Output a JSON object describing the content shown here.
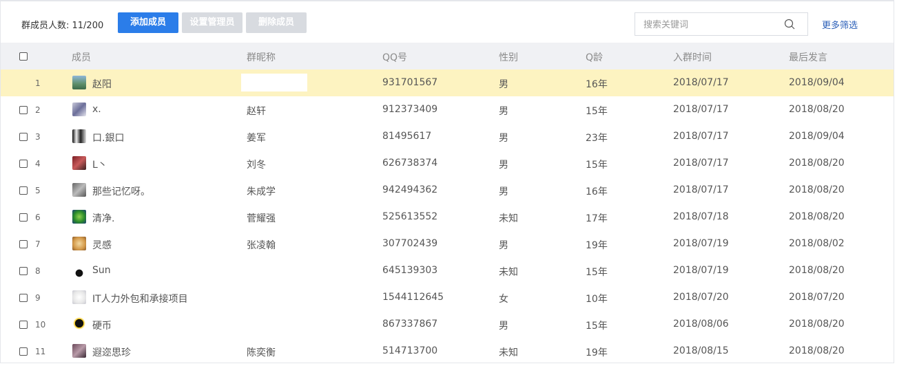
{
  "toolbar": {
    "count_label": "群成员人数: 11/200",
    "add_label": "添加成员",
    "admin_label": "设置管理员",
    "delete_label": "删除成员",
    "search_placeholder": "搜索关键词",
    "more_filter": "更多筛选"
  },
  "columns": {
    "member": "成员",
    "nickname": "群昵称",
    "qq": "QQ号",
    "gender": "性别",
    "qage": "Q龄",
    "join": "入群时间",
    "last": "最后发言"
  },
  "colors": {
    "primary": "#2b7de9",
    "disabled": "#d8dbe0",
    "highlight_row": "#fdf3c1",
    "header_bg": "#f0f1f4",
    "link": "#2b5fb8"
  },
  "rows": [
    {
      "idx": "1",
      "name": "赵阳",
      "nick": "",
      "qq": "931701567",
      "gender": "男",
      "qage": "16年",
      "join": "2018/07/17",
      "last": "2018/09/04",
      "avatar": "landscape-avatar",
      "highlight": true
    },
    {
      "idx": "2",
      "name": "x.",
      "nick": "赵轩",
      "qq": "912373409",
      "gender": "男",
      "qage": "15年",
      "join": "2018/07/17",
      "last": "2018/08/20",
      "avatar": "anime-avatar",
      "highlight": false
    },
    {
      "idx": "3",
      "name": "口.銀口",
      "nick": "姜军",
      "qq": "81495617",
      "gender": "男",
      "qage": "23年",
      "join": "2018/07/17",
      "last": "2018/09/04",
      "avatar": "bw-figure-avatar",
      "highlight": false
    },
    {
      "idx": "4",
      "name": "L丶",
      "nick": "刘冬",
      "qq": "626738374",
      "gender": "男",
      "qage": "15年",
      "join": "2018/07/17",
      "last": "2018/08/20",
      "avatar": "red-photo-avatar",
      "highlight": false
    },
    {
      "idx": "5",
      "name": "那些记忆呀。",
      "nick": "朱成学",
      "qq": "942494362",
      "gender": "男",
      "qage": "16年",
      "join": "2018/07/17",
      "last": "2018/08/20",
      "avatar": "gray-photo-avatar",
      "highlight": false
    },
    {
      "idx": "6",
      "name": "清净.",
      "nick": "菅耀强",
      "qq": "525613552",
      "gender": "未知",
      "qage": "17年",
      "join": "2018/07/18",
      "last": "2018/08/20",
      "avatar": "green-logo-avatar",
      "highlight": false
    },
    {
      "idx": "7",
      "name": "灵感",
      "nick": "张凌翰",
      "qq": "307702439",
      "gender": "男",
      "qage": "19年",
      "join": "2018/07/19",
      "last": "2018/08/02",
      "avatar": "dog-avatar",
      "highlight": false
    },
    {
      "idx": "8",
      "name": "Sun",
      "nick": "",
      "qq": "645139303",
      "gender": "未知",
      "qage": "15年",
      "join": "2018/07/19",
      "last": "2018/08/20",
      "avatar": "silhouette-avatar",
      "highlight": false
    },
    {
      "idx": "9",
      "name": "IT人力外包和承接项目",
      "nick": "",
      "qq": "1544112645",
      "gender": "女",
      "qage": "10年",
      "join": "2018/07/20",
      "last": "2018/07/20",
      "avatar": "cat-avatar",
      "highlight": false
    },
    {
      "idx": "10",
      "name": "硬币",
      "nick": "",
      "qq": "867337867",
      "gender": "男",
      "qage": "15年",
      "join": "2018/08/06",
      "last": "2018/08/20",
      "avatar": "penguin-avatar",
      "highlight": false
    },
    {
      "idx": "11",
      "name": "遐迩思珍",
      "nick": "陈奕衡",
      "qq": "514713700",
      "gender": "未知",
      "qage": "19年",
      "join": "2018/08/15",
      "last": "2018/08/20",
      "avatar": "portrait-avatar",
      "highlight": false
    }
  ]
}
